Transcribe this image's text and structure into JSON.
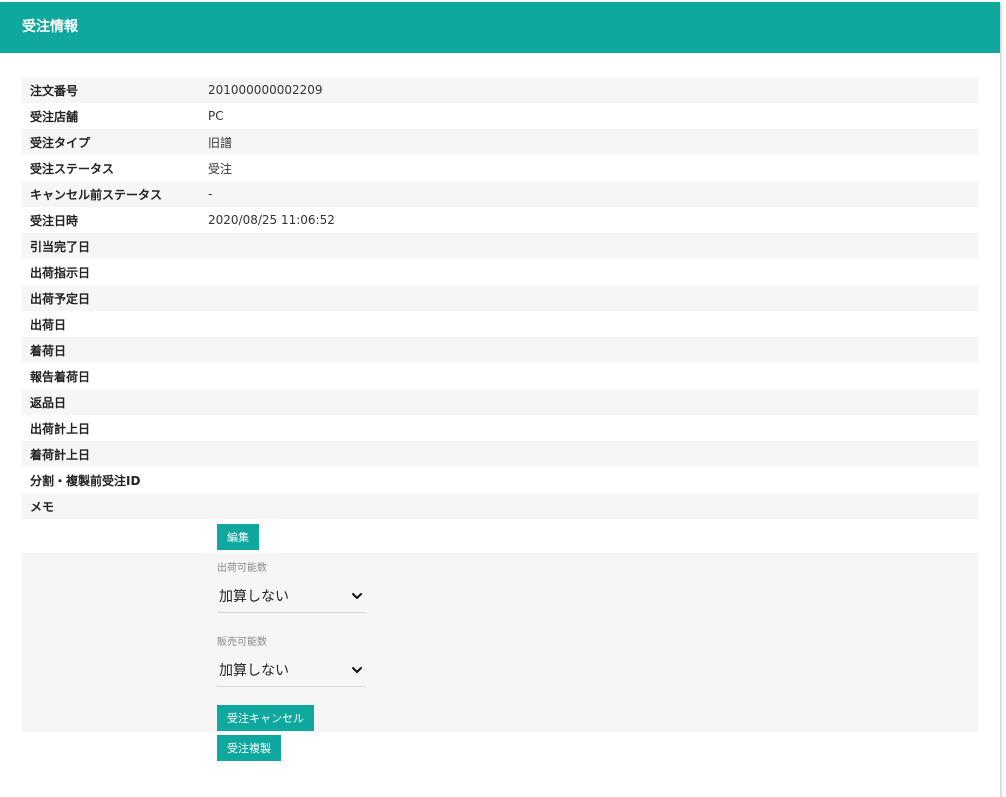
{
  "header": {
    "title": "受注情報"
  },
  "rows": [
    {
      "label": "注文番号",
      "value": "201000000002209"
    },
    {
      "label": "受注店舗",
      "value": "PC"
    },
    {
      "label": "受注タイプ",
      "value": "旧譜"
    },
    {
      "label": "受注ステータス",
      "value": "受注"
    },
    {
      "label": "キャンセル前ステータス",
      "value": "-"
    },
    {
      "label": "受注日時",
      "value": "2020/08/25 11:06:52"
    },
    {
      "label": "引当完了日",
      "value": ""
    },
    {
      "label": "出荷指示日",
      "value": ""
    },
    {
      "label": "出荷予定日",
      "value": ""
    },
    {
      "label": "出荷日",
      "value": ""
    },
    {
      "label": "着荷日",
      "value": ""
    },
    {
      "label": "報告着荷日",
      "value": ""
    },
    {
      "label": "返品日",
      "value": ""
    },
    {
      "label": "出荷計上日",
      "value": ""
    },
    {
      "label": "着荷計上日",
      "value": ""
    },
    {
      "label": "分割・複製前受注ID",
      "value": ""
    },
    {
      "label": "メモ",
      "value": ""
    }
  ],
  "buttons": {
    "edit": "編集",
    "cancel_order": "受注キャンセル",
    "copy_order": "受注複製"
  },
  "fields": {
    "shippable": {
      "label": "出荷可能数",
      "selected": "加算しない"
    },
    "sellable": {
      "label": "販売可能数",
      "selected": "加算しない"
    }
  },
  "colors": {
    "accent": "#0ea89e",
    "stripe": "#f5f6f5"
  }
}
